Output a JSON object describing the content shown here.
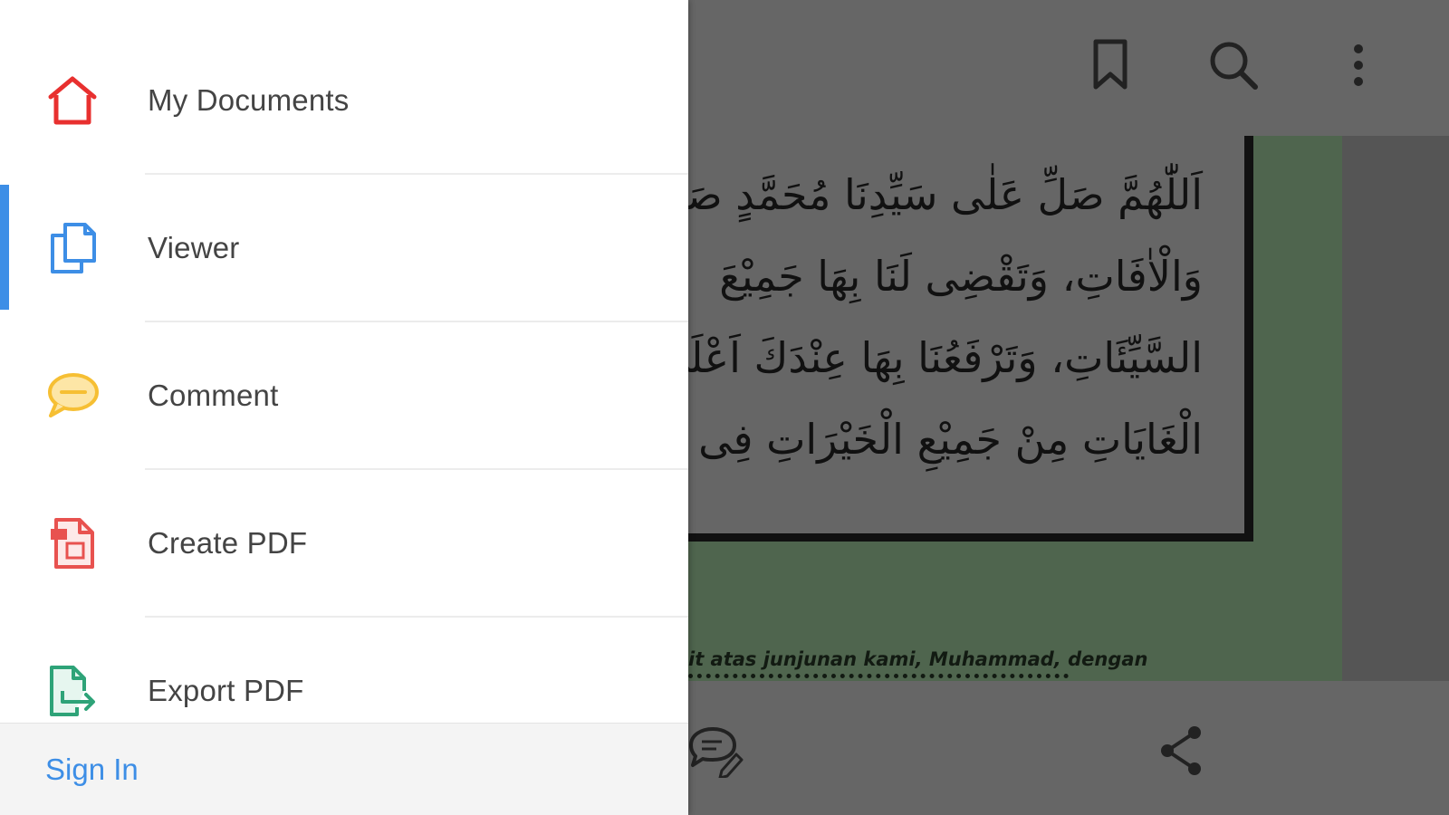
{
  "colors": {
    "accent_blue": "#3d8ee6",
    "home_red": "#e8302f",
    "comment_yellow": "#f6bf33",
    "create_red": "#e8524f",
    "export_green": "#2ea378",
    "page_green": "#4f654e",
    "overlay_gray": "#666666"
  },
  "drawer": {
    "items": [
      {
        "label": "My Documents",
        "icon": "home-icon",
        "active": false
      },
      {
        "label": "Viewer",
        "icon": "documents-icon",
        "active": true
      },
      {
        "label": "Comment",
        "icon": "comment-bubble-icon",
        "active": false
      },
      {
        "label": "Create PDF",
        "icon": "create-pdf-icon",
        "active": false
      },
      {
        "label": "Export PDF",
        "icon": "export-pdf-icon",
        "active": false
      }
    ],
    "sign_in_label": "Sign In"
  },
  "viewer": {
    "toolbar_icons": [
      "bookmark-icon",
      "search-icon",
      "more-vert-icon"
    ],
    "bottom_icons": [
      "comment-edit-icon",
      "share-icon"
    ],
    "arabic_lines": [
      "اَللّٰهُمَّ صَلِّ عَلٰى سَيِّدِنَا مُحَمَّدٍ صَلَاةً",
      "وَالْاٰفَاتِ، وَتَقْضِى لَنَا بِهَا جَمِيْعَ",
      "السَّيِّئَاتِ، وَتَرْفَعُنَا بِهَا عِنْدَكَ اَعْلَى",
      "الْغَايَاتِ مِنْ جَمِيْعِ الْخَيْرَاتِ فِى الْحَيَاةِ وَبَ"
    ],
    "caption": "it atas junjunan kami, Muhammad, dengan"
  }
}
